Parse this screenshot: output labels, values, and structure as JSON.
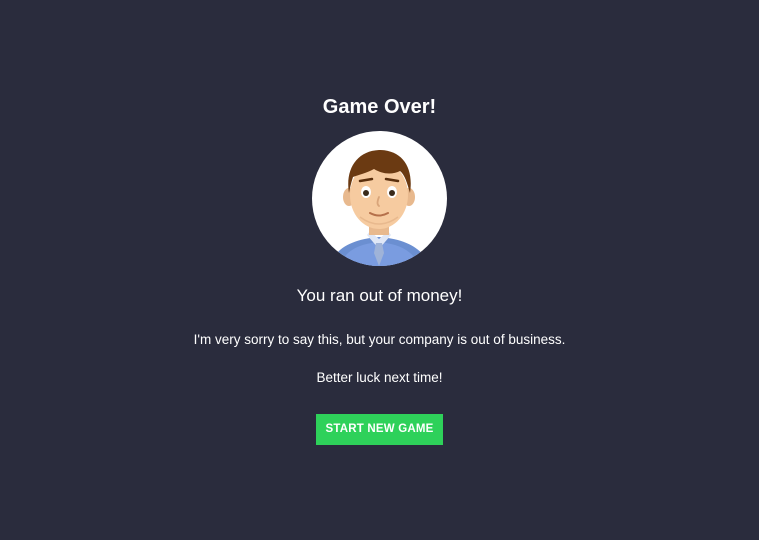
{
  "dialog": {
    "title": "Game Over!",
    "subtitle": "You ran out of money!",
    "message": "I'm very sorry to say this, but your company is out of business.",
    "message2": "Better luck next time!",
    "button_label": "START NEW GAME"
  },
  "avatar": {
    "icon": "businessman-avatar-icon"
  },
  "colors": {
    "background": "#2a2c3d",
    "text": "#ffffff",
    "button": "#2ed15a",
    "avatar_background": "#ffffff"
  }
}
